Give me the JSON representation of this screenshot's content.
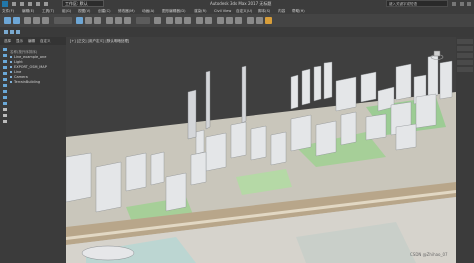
{
  "titlebar": {
    "workspace": "工作区: 默认",
    "title": "Autodesk 3ds Max 2017    无标题",
    "search_placeholder": "键入关键字或短语"
  },
  "menubar": {
    "items": [
      "文件(F)",
      "编辑(E)",
      "工具(T)",
      "组(G)",
      "视图(V)",
      "创建(C)",
      "修改器(M)",
      "动画(A)",
      "图形编辑器(D)",
      "渲染(R)",
      "Civil View",
      "自定义(U)",
      "脚本(S)",
      "内容",
      "帮助(H)"
    ]
  },
  "left_panel": {
    "tabs": [
      "选择",
      "显示",
      "编辑",
      "自定义"
    ],
    "scene_items": [
      "名称(按升序排序)",
      "Line_example_one",
      "Light",
      "EXPORT_OSM_MAP",
      "Line",
      "Camera",
      "TerrainBuilding"
    ]
  },
  "viewport": {
    "label": "[+] [正交] [用户定义] [默认明暗处理]"
  },
  "right_panel": {
    "tabs": [
      "",
      "",
      "",
      "",
      ""
    ]
  },
  "watermark": "CSDN @Zhihao_07",
  "colors": {
    "background": "#3f3f3f",
    "ground": "#c8c4b8",
    "buildings": "#e2e4e6",
    "green": "#9ccc94",
    "accent": "#5fa8e0"
  }
}
